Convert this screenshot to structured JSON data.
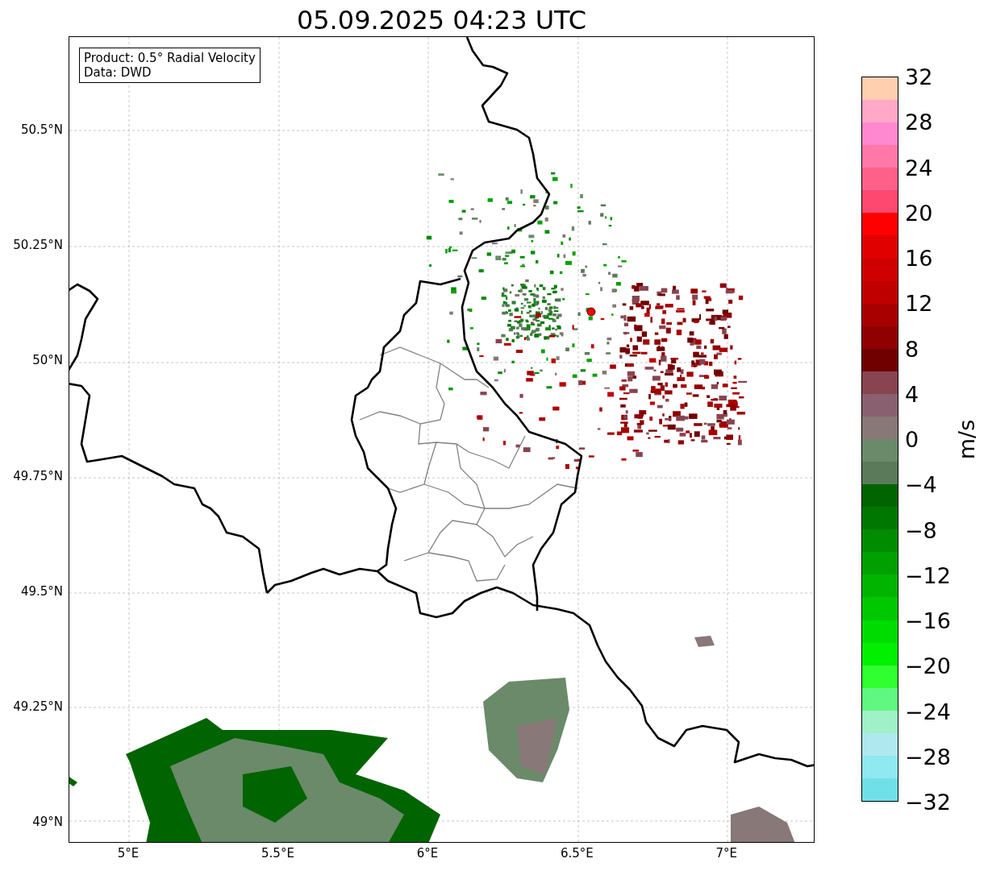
{
  "title": "05.09.2025 04:23 UTC",
  "legend": {
    "lines": [
      "Product: 0.5° Radial Velocity",
      "Data: DWD"
    ]
  },
  "map": {
    "lat_ticks": [
      "50.5°N",
      "50.25°N",
      "50°N",
      "49.75°N",
      "49.5°N",
      "49.25°N",
      "49°N"
    ],
    "lon_ticks": [
      "5°E",
      "5.5°E",
      "6°E",
      "6.5°E",
      "7°E"
    ]
  },
  "colorbar": {
    "label": "m/s",
    "ticks": [
      "32",
      "28",
      "24",
      "20",
      "16",
      "12",
      "8",
      "4",
      "0",
      "−4",
      "−8",
      "−12",
      "−16",
      "−20",
      "−24",
      "−28",
      "−32"
    ],
    "bins": [
      {
        "color": "#ffcfb0"
      },
      {
        "color": "#ffa8c8"
      },
      {
        "color": "#ff88d0"
      },
      {
        "color": "#ff78a8"
      },
      {
        "color": "#ff6088"
      },
      {
        "color": "#ff4870"
      },
      {
        "color": "#ff0000"
      },
      {
        "color": "#e00000"
      },
      {
        "color": "#d00000"
      },
      {
        "color": "#c00000"
      },
      {
        "color": "#a80000"
      },
      {
        "color": "#900000"
      },
      {
        "color": "#700000"
      },
      {
        "color": "#884450"
      },
      {
        "color": "#886070"
      },
      {
        "color": "#887878"
      },
      {
        "color": "#6a8a6a"
      },
      {
        "color": "#5a7a5a"
      },
      {
        "color": "#006400"
      },
      {
        "color": "#007800"
      },
      {
        "color": "#008c00"
      },
      {
        "color": "#00a000"
      },
      {
        "color": "#00b400"
      },
      {
        "color": "#00c800"
      },
      {
        "color": "#00dc00"
      },
      {
        "color": "#00f000"
      },
      {
        "color": "#30ff30"
      },
      {
        "color": "#60f880"
      },
      {
        "color": "#a0f0c8"
      },
      {
        "color": "#b0e8f0"
      },
      {
        "color": "#90e8f0"
      },
      {
        "color": "#70e0e8"
      }
    ]
  }
}
